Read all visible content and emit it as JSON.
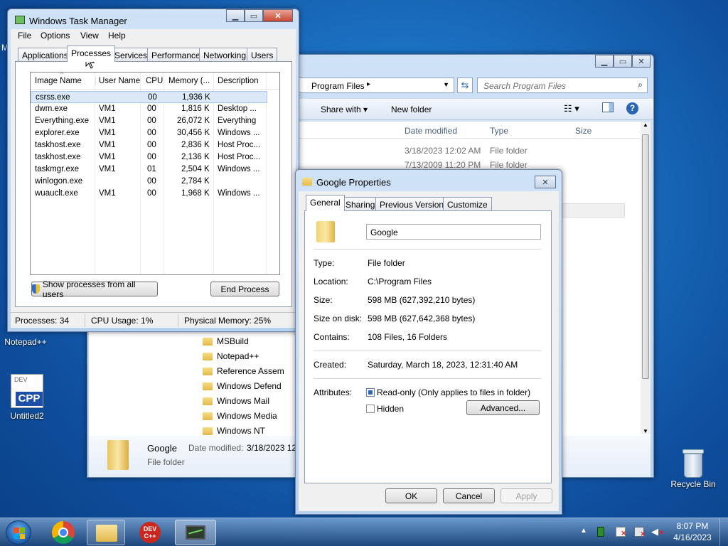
{
  "desktop": {
    "icons": [
      {
        "label": "Notepad++"
      },
      {
        "label": "Untitled2",
        "glyph_top": "DEV",
        "glyph_bottom": "CPP"
      },
      {
        "label": "Recycle Bin"
      }
    ],
    "partial_text": "M"
  },
  "explorer": {
    "breadcrumb": "Program Files",
    "search_placeholder": "Search Program Files",
    "toolbar": {
      "share": "Share with",
      "new_folder": "New folder"
    },
    "columns": [
      "Date modified",
      "Type",
      "Size"
    ],
    "rows": [
      {
        "date": "3/18/2023 12:02 AM",
        "type": "File folder"
      },
      {
        "date": "7/13/2009 11:20 PM",
        "type": "File folder"
      }
    ],
    "tree": [
      "MSBuild",
      "Notepad++",
      "Reference Assem",
      "Windows Defend",
      "Windows Mail",
      "Windows Media",
      "Windows NT"
    ],
    "details": {
      "name": "Google",
      "type": "File folder",
      "date_label": "Date modified:",
      "date": "3/18/2023 12"
    }
  },
  "taskmgr": {
    "title": "Windows Task Manager",
    "menu": [
      "File",
      "Options",
      "View",
      "Help"
    ],
    "tabs": [
      "Applications",
      "Processes",
      "Services",
      "Performance",
      "Networking",
      "Users"
    ],
    "columns": [
      "Image Name",
      "User Name",
      "CPU",
      "Memory (...",
      "Description"
    ],
    "rows": [
      {
        "name": "csrss.exe",
        "user": "",
        "cpu": "00",
        "mem": "1,936 K",
        "desc": ""
      },
      {
        "name": "dwm.exe",
        "user": "VM1",
        "cpu": "00",
        "mem": "1,816 K",
        "desc": "Desktop ..."
      },
      {
        "name": "Everything.exe",
        "user": "VM1",
        "cpu": "00",
        "mem": "26,072 K",
        "desc": "Everything"
      },
      {
        "name": "explorer.exe",
        "user": "VM1",
        "cpu": "00",
        "mem": "30,456 K",
        "desc": "Windows ..."
      },
      {
        "name": "taskhost.exe",
        "user": "VM1",
        "cpu": "00",
        "mem": "2,836 K",
        "desc": "Host Proc..."
      },
      {
        "name": "taskhost.exe",
        "user": "VM1",
        "cpu": "00",
        "mem": "2,136 K",
        "desc": "Host Proc..."
      },
      {
        "name": "taskmgr.exe",
        "user": "VM1",
        "cpu": "01",
        "mem": "2,504 K",
        "desc": "Windows ..."
      },
      {
        "name": "winlogon.exe",
        "user": "",
        "cpu": "00",
        "mem": "2,784 K",
        "desc": ""
      },
      {
        "name": "wuauclt.exe",
        "user": "VM1",
        "cpu": "00",
        "mem": "1,968 K",
        "desc": "Windows ..."
      }
    ],
    "show_all_button": "Show processes from all users",
    "end_process_button": "End Process",
    "status": {
      "processes": "Processes: 34",
      "cpu": "CPU Usage: 1%",
      "memory": "Physical Memory: 25%"
    }
  },
  "props": {
    "title": "Google Properties",
    "tabs": [
      "General",
      "Sharing",
      "Previous Versions",
      "Customize"
    ],
    "name_value": "Google",
    "fields": [
      {
        "label": "Type:",
        "value": "File folder"
      },
      {
        "label": "Location:",
        "value": "C:\\Program Files"
      },
      {
        "label": "Size:",
        "value": "598 MB (627,392,210 bytes)"
      },
      {
        "label": "Size on disk:",
        "value": "598 MB (627,642,368 bytes)"
      },
      {
        "label": "Contains:",
        "value": "108 Files, 16 Folders"
      }
    ],
    "created_label": "Created:",
    "created_value": "Saturday, March 18, 2023, 12:31:40 AM",
    "attributes_label": "Attributes:",
    "readonly_label": "Read-only (Only applies to files in folder)",
    "hidden_label": "Hidden",
    "advanced_button": "Advanced...",
    "ok": "OK",
    "cancel": "Cancel",
    "apply": "Apply"
  },
  "taskbar": {
    "time": "8:07 PM",
    "date": "4/16/2023",
    "devcpp_label": "DEV C++"
  }
}
